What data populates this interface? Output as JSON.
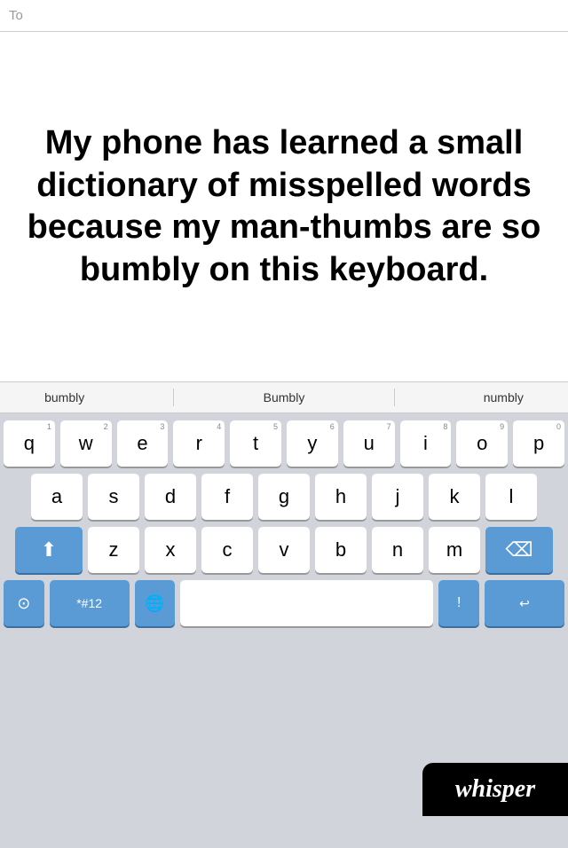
{
  "message_area": {
    "to_label": "To",
    "main_text": "My phone has learned a small dictionary of misspelled words because my man-thumbs are so bumbly on this keyboard."
  },
  "suggestions": {
    "items": [
      "bumbly",
      "Bumbly",
      "numbly"
    ]
  },
  "keyboard": {
    "rows": {
      "row1": [
        "q",
        "w",
        "e",
        "r",
        "t",
        "y",
        "u",
        "i",
        "o",
        "p"
      ],
      "row2": [
        "a",
        "s",
        "d",
        "f",
        "g",
        "h",
        "j",
        "k",
        "l"
      ],
      "row3": [
        "z",
        "x",
        "c",
        "v",
        "b",
        "n",
        "m"
      ]
    },
    "num_hints": [
      "1",
      "2",
      "3",
      "4",
      "5",
      "6",
      "7",
      "8",
      "9",
      "0"
    ],
    "shift_label": "⬆",
    "backspace_label": "⌫",
    "num_switch_label": "*#12",
    "spacebar_label": "",
    "return_label": "↩",
    "globe_label": "🌐",
    "camera_label": "📷"
  },
  "whisper": {
    "label": "whisper"
  }
}
